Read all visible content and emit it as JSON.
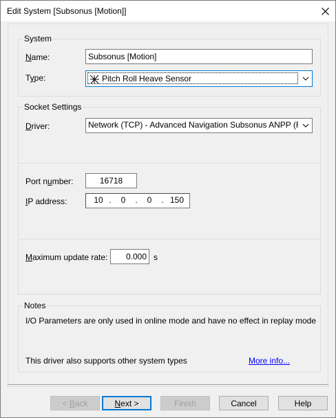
{
  "window": {
    "title": "Edit System [Subsonus [Motion]]"
  },
  "system_group": {
    "label": "System",
    "name_label": "Name:",
    "name_value": "Subsonus [Motion]",
    "type_label": "Type:",
    "type_value": "Pitch Roll Heave Sensor"
  },
  "socket_group": {
    "label": "Socket Settings",
    "driver_label": "Driver:",
    "driver_value": "Network (TCP) - Advanced Navigation Subsonus ANPP (Roll Pitc",
    "port_label": "Port number:",
    "port_value": "16718",
    "ip_label": "IP address:",
    "ip_octets": [
      "10",
      "0",
      "0",
      "150"
    ],
    "rate_label": "Maximum update rate:",
    "rate_value": "0.000",
    "rate_unit": "s"
  },
  "notes_group": {
    "label": "Notes",
    "line1": "I/O Parameters are only used in online mode and have no effect in replay mode",
    "line2": "This driver also supports other system types",
    "more_info": "More info..."
  },
  "buttons": {
    "back": "< Back",
    "next": "Next >",
    "finish": "Finish",
    "cancel": "Cancel",
    "help": "Help"
  },
  "colors": {
    "accent": "#0078d7",
    "link": "#0000ff"
  }
}
